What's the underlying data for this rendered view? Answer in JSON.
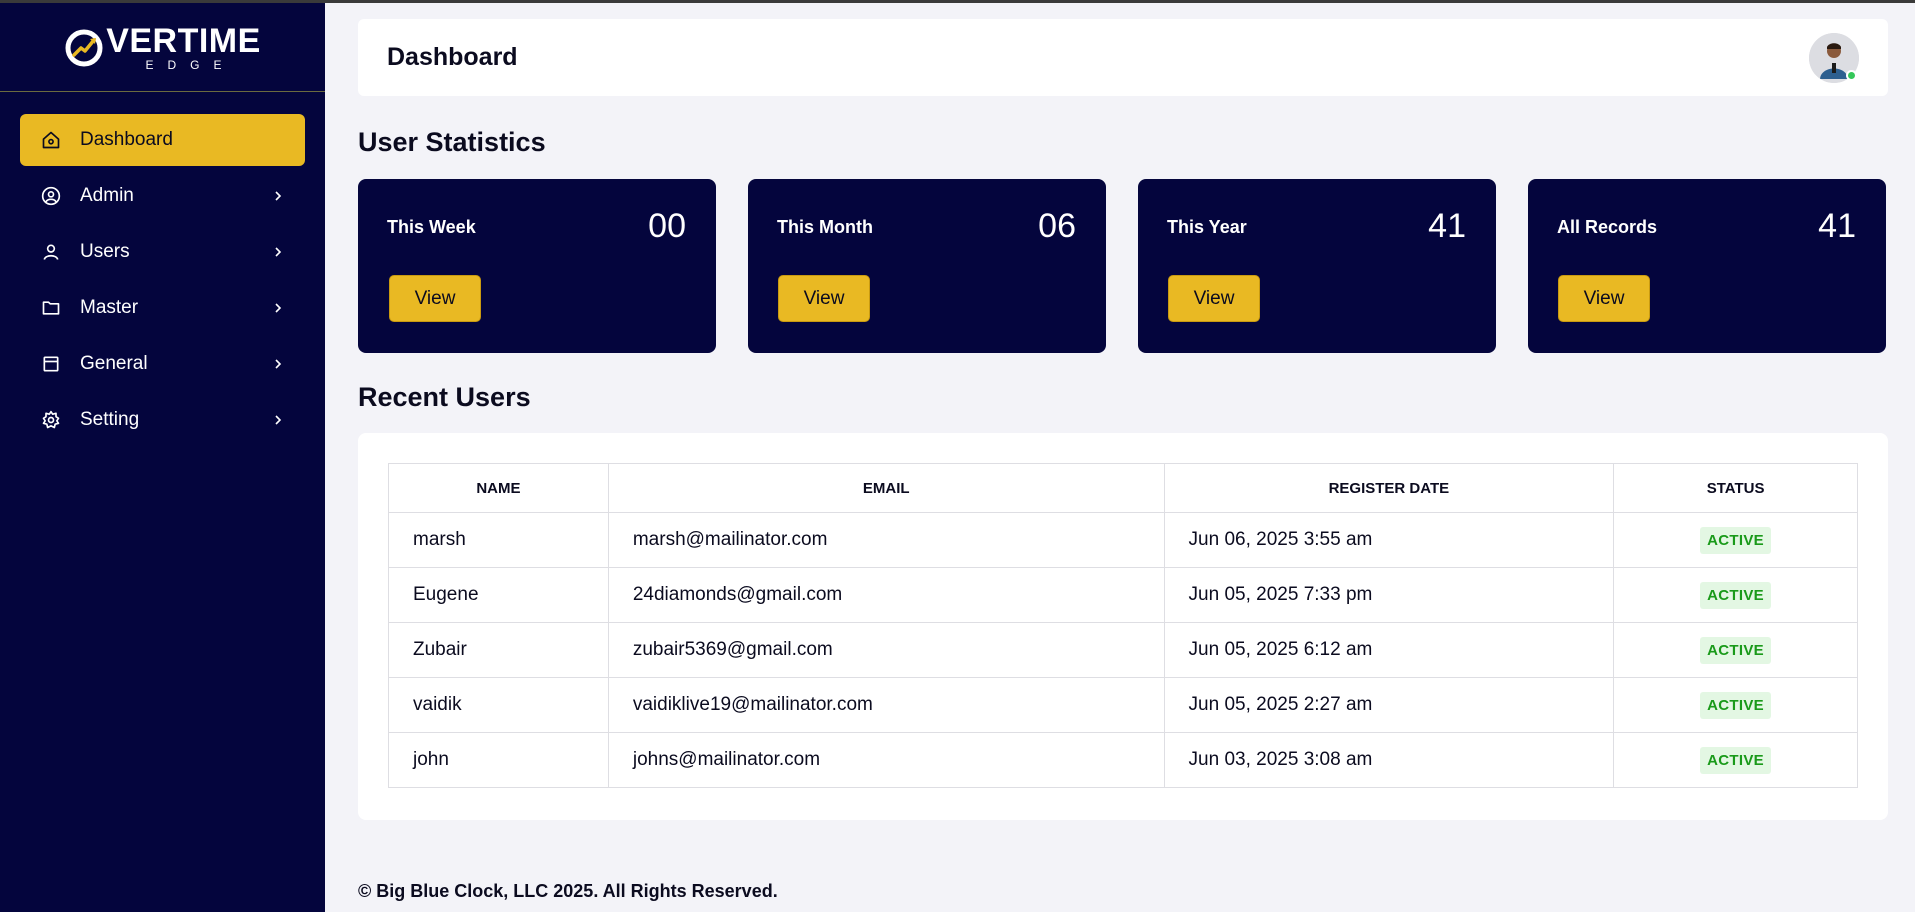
{
  "brand": {
    "name_main": "VERTIME",
    "name_sub": "EDGE",
    "accent": "#e9b923",
    "sidebar_bg": "#04053d"
  },
  "sidebar": {
    "items": [
      {
        "label": "Dashboard",
        "icon": "home-icon",
        "active": true
      },
      {
        "label": "Admin",
        "icon": "user-circle-icon"
      },
      {
        "label": "Users",
        "icon": "user-icon"
      },
      {
        "label": "Master",
        "icon": "folder-icon"
      },
      {
        "label": "General",
        "icon": "calendar-icon"
      },
      {
        "label": "Setting",
        "icon": "gear-icon"
      }
    ]
  },
  "header": {
    "title": "Dashboard",
    "avatar_icon": "user-avatar",
    "online_color": "#34c759"
  },
  "stats_section": {
    "title": "User Statistics",
    "cards": [
      {
        "label": "This Week",
        "value": "00",
        "button": "View"
      },
      {
        "label": "This Month",
        "value": "06",
        "button": "View"
      },
      {
        "label": "This Year",
        "value": "41",
        "button": "View"
      },
      {
        "label": "All Records",
        "value": "41",
        "button": "View"
      }
    ]
  },
  "recent_users": {
    "title": "Recent Users",
    "columns": [
      "NAME",
      "EMAIL",
      "REGISTER DATE",
      "STATUS"
    ],
    "rows": [
      {
        "name": "marsh",
        "email": "marsh@mailinator.com",
        "date": "Jun 06, 2025 3:55 am",
        "status": "ACTIVE"
      },
      {
        "name": "Eugene",
        "email": "24diamonds@gmail.com",
        "date": "Jun 05, 2025 7:33 pm",
        "status": "ACTIVE"
      },
      {
        "name": "Zubair",
        "email": "zubair5369@gmail.com",
        "date": "Jun 05, 2025 6:12 am",
        "status": "ACTIVE"
      },
      {
        "name": "vaidik",
        "email": "vaidiklive19@mailinator.com",
        "date": "Jun 05, 2025 2:27 am",
        "status": "ACTIVE"
      },
      {
        "name": "john",
        "email": "johns@mailinator.com",
        "date": "Jun 03, 2025 3:08 am",
        "status": "ACTIVE"
      }
    ]
  },
  "footer": {
    "text": "© Big Blue Clock, LLC 2025. All Rights Reserved."
  }
}
